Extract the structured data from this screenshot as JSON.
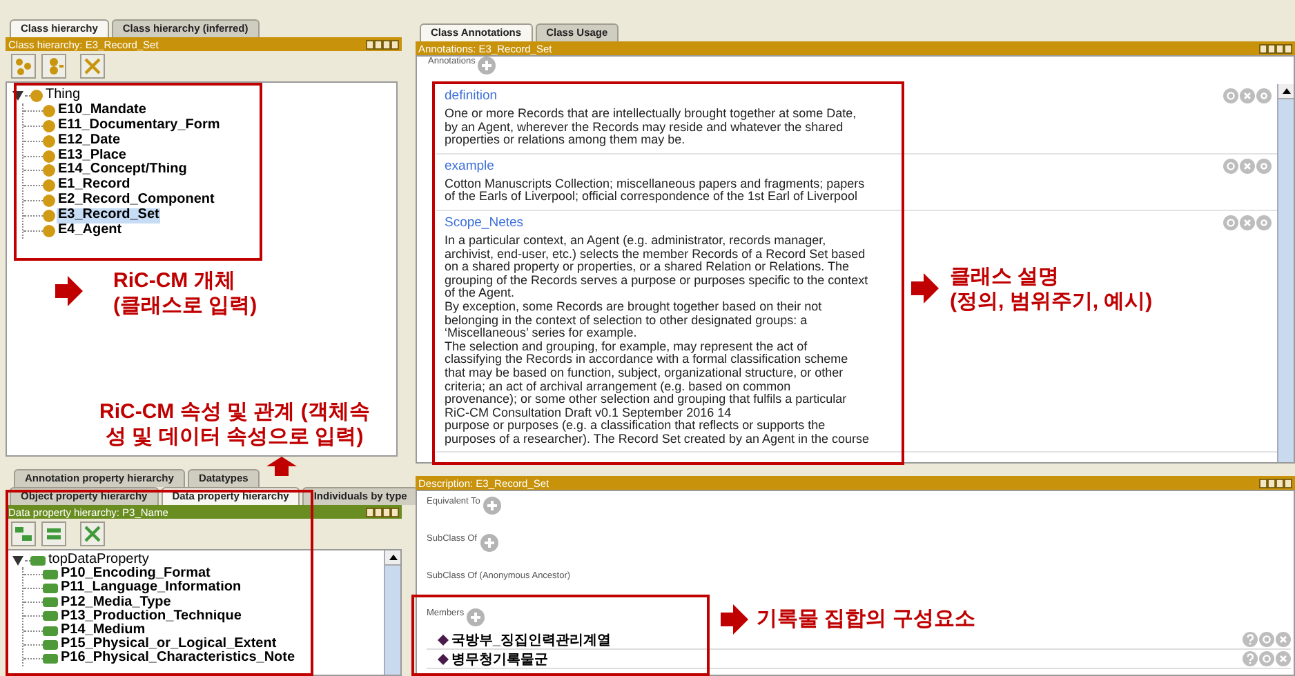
{
  "class_hierarchy": {
    "tabs": [
      {
        "label": "Class hierarchy",
        "selected": true
      },
      {
        "label": "Class hierarchy (inferred)",
        "selected": false
      }
    ],
    "title": "Class hierarchy: E3_Record_Set",
    "tree": {
      "label": "Thing",
      "expanded": true,
      "children": [
        {
          "label": "E10_Mandate",
          "selected": false
        },
        {
          "label": "E11_Documentary_Form",
          "selected": false
        },
        {
          "label": "E12_Date",
          "selected": false
        },
        {
          "label": "E13_Place",
          "selected": false
        },
        {
          "label": "E14_Concept/Thing",
          "selected": false
        },
        {
          "label": "E1_Record",
          "selected": false
        },
        {
          "label": "E2_Record_Component",
          "selected": false
        },
        {
          "label": "E3_Record_Set",
          "selected": true
        },
        {
          "label": "E4_Agent",
          "selected": false
        }
      ]
    }
  },
  "property_hierarchy": {
    "tabs_back": [
      {
        "label": "Annotation property hierarchy",
        "selected": false
      },
      {
        "label": "Datatypes",
        "selected": false
      }
    ],
    "tabs_front": [
      {
        "label": "Object property hierarchy",
        "selected": false
      },
      {
        "label": "Data property hierarchy",
        "selected": true
      },
      {
        "label": "Individuals by type",
        "selected": false
      }
    ],
    "title": "Data property hierarchy: P3_Name",
    "tree": {
      "label": "topDataProperty",
      "expanded": true,
      "children": [
        {
          "label": "P10_Encoding_Format",
          "selected": false
        },
        {
          "label": "P11_Language_Information",
          "selected": false
        },
        {
          "label": "P12_Media_Type",
          "selected": false
        },
        {
          "label": "P13_Production_Technique",
          "selected": false
        },
        {
          "label": "P14_Medium",
          "selected": false
        },
        {
          "label": "P15_Physical_or_Logical_Extent",
          "selected": false
        },
        {
          "label": "P16_Physical_Characteristics_Note",
          "selected": false
        }
      ]
    }
  },
  "annotations_panel": {
    "tabs": [
      {
        "label": "Class Annotations",
        "selected": true
      },
      {
        "label": "Class Usage",
        "selected": false
      }
    ],
    "title": "Annotations: E3_Record_Set",
    "section_label": "Annotations",
    "items": [
      {
        "property": "definition",
        "lines": [
          "One or more Records that are intellectually brought together at some Date,",
          "by an Agent, wherever the Records may reside and whatever the shared",
          "properties or relations among them may be."
        ]
      },
      {
        "property": "example",
        "lines": [
          "Cotton Manuscripts Collection; miscellaneous papers and fragments; papers",
          "of the Earls of Liverpool; official correspondence of the 1st Earl of Liverpool"
        ]
      },
      {
        "property": "Scope_Netes",
        "lines": [
          "In a particular context, an Agent (e.g. administrator, records manager,",
          "archivist, end-user, etc.) selects the member Records of a Record Set based",
          "on a shared property or properties, or a shared Relation or Relations. The",
          "grouping of the Records serves a purpose or purposes specific to the context",
          "of the Agent.",
          "By exception, some Records are brought together based on their not",
          "belonging in the context of selection to other designated groups: a",
          "‘Miscellaneous’ series for example.",
          "The selection and grouping, for example, may represent the act of",
          "classifying the Records in accordance with a formal classification scheme",
          "that may be based on function, subject, organizational structure, or other",
          "criteria; an act of archival arrangement (e.g. based on common",
          "provenance); or some other selection and grouping that fulfils a particular",
          "RiC-CM Consultation Draft v0.1 September 2016 14",
          "purpose or purposes (e.g. a classification that reflects or supports the",
          "purposes of a researcher). The Record Set created by an Agent in the course"
        ]
      }
    ]
  },
  "description_panel": {
    "title": "Description: E3_Record_Set",
    "sections": [
      {
        "label": "Equivalent To",
        "addable": true
      },
      {
        "label": "SubClass Of",
        "addable": true
      },
      {
        "label": "SubClass Of (Anonymous Ancestor)",
        "addable": false
      }
    ],
    "members_label": "Members",
    "members": [
      "국방부_징집인력관리계열",
      "병무청기록물군"
    ]
  },
  "callouts": [
    {
      "lines": [
        "RiC-CM 개체",
        "(클래스로 입력)"
      ],
      "kind": "right"
    },
    {
      "lines": [
        "RiC-CM 속성 및 관계 (객체속",
        "성 및 데이터 속성으로 입력)"
      ],
      "kind": "up"
    },
    {
      "lines": [
        "클래스 설명",
        "(정의, 범위주기, 예시)"
      ],
      "kind": "right"
    },
    {
      "lines": [
        "기록물 집합의 구성요소"
      ],
      "kind": "right"
    }
  ]
}
